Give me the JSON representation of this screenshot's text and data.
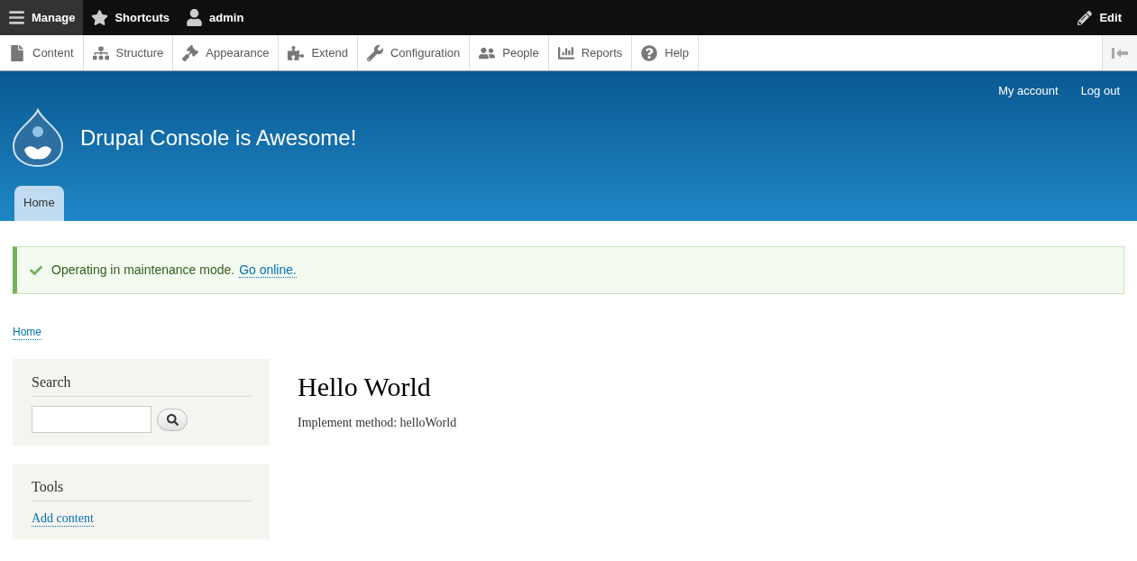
{
  "toolbar": {
    "items": [
      {
        "label": "Manage",
        "selected": true
      },
      {
        "label": "Shortcuts",
        "selected": false
      },
      {
        "label": "admin",
        "selected": false
      }
    ],
    "edit": "Edit"
  },
  "tray": {
    "items": [
      {
        "label": "Content"
      },
      {
        "label": "Structure"
      },
      {
        "label": "Appearance"
      },
      {
        "label": "Extend"
      },
      {
        "label": "Configuration"
      },
      {
        "label": "People"
      },
      {
        "label": "Reports"
      },
      {
        "label": "Help"
      }
    ]
  },
  "header": {
    "user_links": [
      "My account",
      "Log out"
    ],
    "site_name": "Drupal Console is Awesome!",
    "tabs": [
      {
        "label": "Home",
        "selected": true
      }
    ]
  },
  "message": {
    "text": "Operating in maintenance mode.",
    "link": "Go online."
  },
  "breadcrumb": [
    "Home"
  ],
  "sidebar": [
    {
      "kind": "search",
      "title": "Search"
    },
    {
      "kind": "links",
      "title": "Tools",
      "links": [
        "Add content"
      ]
    }
  ],
  "content": {
    "title": "Hello World",
    "body": "Implement method: helloWorld"
  }
}
